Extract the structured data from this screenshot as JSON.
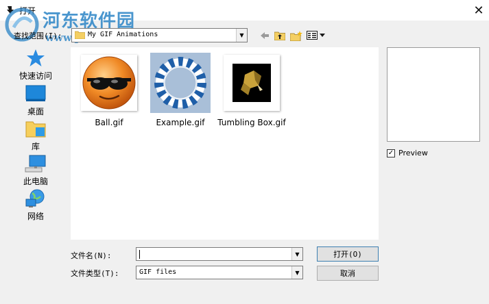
{
  "window": {
    "title": "打开",
    "close_glyph": "✕"
  },
  "watermark": {
    "title": "河东软件园",
    "url": "www.pc0359.cn"
  },
  "lookin": {
    "label": "查找范围(I):",
    "value": "My GIF Animations",
    "folder_icon": "folder-icon"
  },
  "places": [
    {
      "label": "快速访问",
      "icon": "star-icon"
    },
    {
      "label": "桌面",
      "icon": "desktop-icon"
    },
    {
      "label": "库",
      "icon": "library-icon"
    },
    {
      "label": "此电脑",
      "icon": "computer-icon"
    },
    {
      "label": "网络",
      "icon": "network-icon"
    }
  ],
  "files": [
    {
      "name": "Ball.gif",
      "icon": "sunglasses-smiley-thumbnail",
      "selected": false
    },
    {
      "name": "Example.gif",
      "icon": "striped-ring-thumbnail",
      "selected": true
    },
    {
      "name": "Tumbling Box.gif",
      "icon": "tumbling-box-thumbnail",
      "selected": false
    }
  ],
  "preview": {
    "label": "Preview",
    "checked": true,
    "check_glyph": "✓"
  },
  "filename": {
    "label": "文件名(N):",
    "value": ""
  },
  "filetype": {
    "label": "文件类型(T):",
    "value": "GIF files"
  },
  "buttons": {
    "open": "打开(O)",
    "cancel": "取消"
  },
  "colors": {
    "selection": "#a9bfd8",
    "watermark": "#2b84c6",
    "accent_border": "#3c7fb1"
  }
}
